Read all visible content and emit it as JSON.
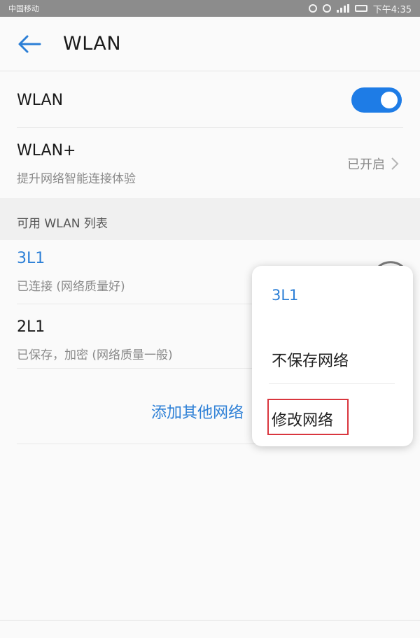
{
  "status_bar": {
    "carrier": "中国移动",
    "time": "下午4:35"
  },
  "header": {
    "title": "WLAN"
  },
  "wlan_toggle": {
    "label": "WLAN",
    "enabled": true,
    "accent_color": "#1e7ce6"
  },
  "wlan_plus": {
    "label": "WLAN+",
    "description": "提升网络智能连接体验",
    "status": "已开启"
  },
  "available_section": {
    "header": "可用 WLAN 列表"
  },
  "networks": [
    {
      "name": "3L1",
      "status": "已连接 (网络质量好)",
      "connected": true
    },
    {
      "name": "2L1",
      "status": "已保存，加密 (网络质量一般)",
      "connected": false
    }
  ],
  "add_network": {
    "label": "添加其他网络"
  },
  "context_menu": {
    "title": "3L1",
    "items": [
      "不保存网络",
      "修改网络"
    ],
    "highlight_color": "#d9363e"
  }
}
